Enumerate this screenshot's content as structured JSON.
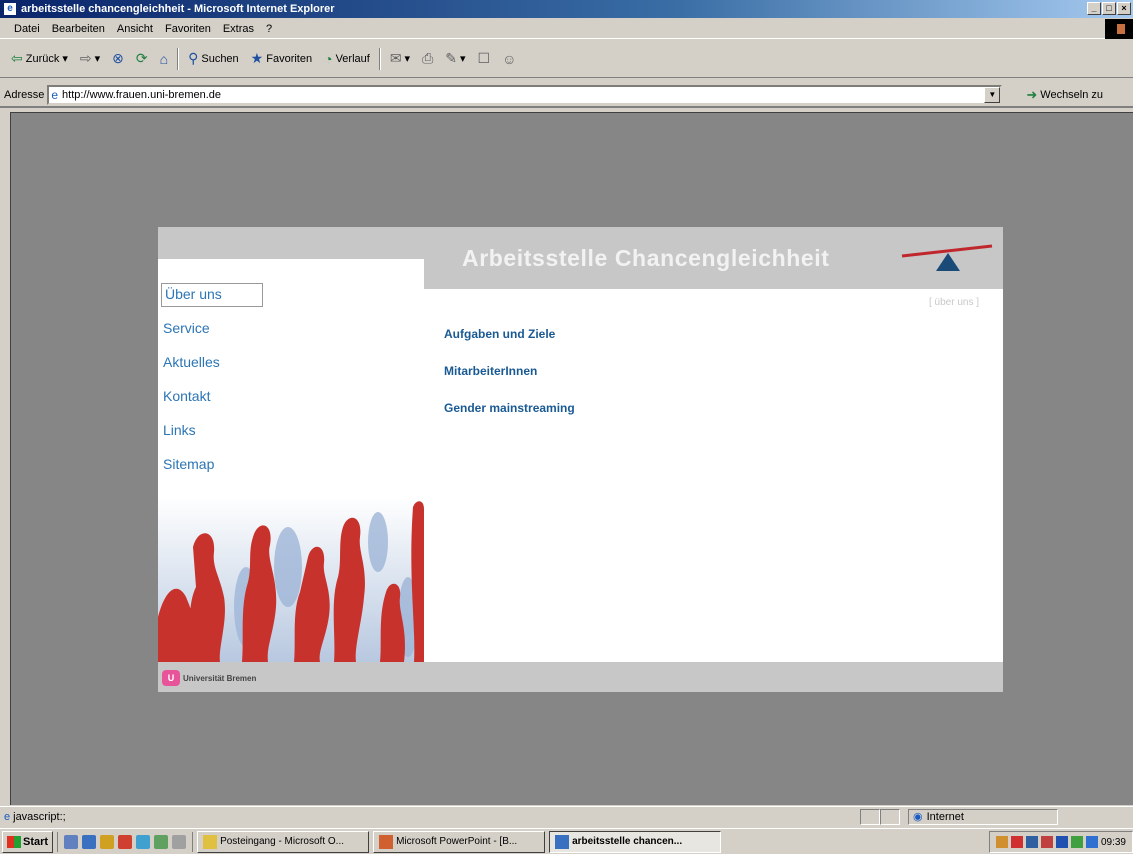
{
  "window": {
    "title": "arbeitsstelle chancengleichheit - Microsoft Internet Explorer"
  },
  "menu": [
    "Datei",
    "Bearbeiten",
    "Ansicht",
    "Favoriten",
    "Extras",
    "?"
  ],
  "toolbar": {
    "back": "Zurück",
    "search": "Suchen",
    "favorites": "Favoriten",
    "history": "Verlauf"
  },
  "address": {
    "label": "Adresse",
    "url": "http://www.frauen.uni-bremen.de",
    "go_label": "Wechseln zu"
  },
  "site": {
    "title": "Arbeitsstelle Chancengleichheit",
    "breadcrumb": "[ über uns ]",
    "nav": [
      "Über uns",
      "Service",
      "Aktuelles",
      "Kontakt",
      "Links",
      "Sitemap"
    ],
    "links": [
      "Aufgaben und Ziele",
      "MitarbeiterInnen",
      "Gender mainstreaming"
    ],
    "footer_logo": "Universität Bremen"
  },
  "status": {
    "text": "javascript:;",
    "zone": "Internet"
  },
  "taskbar": {
    "start": "Start",
    "tasks": [
      "Posteingang - Microsoft O...",
      "Microsoft PowerPoint - [B...",
      "arbeitsstelle chancen..."
    ],
    "clock": "09:39"
  },
  "colors": {
    "accent_red": "#c0272d",
    "link_blue": "#1a5a94",
    "nav_blue": "#2c75b5",
    "header_gray": "#c7c7c7"
  }
}
